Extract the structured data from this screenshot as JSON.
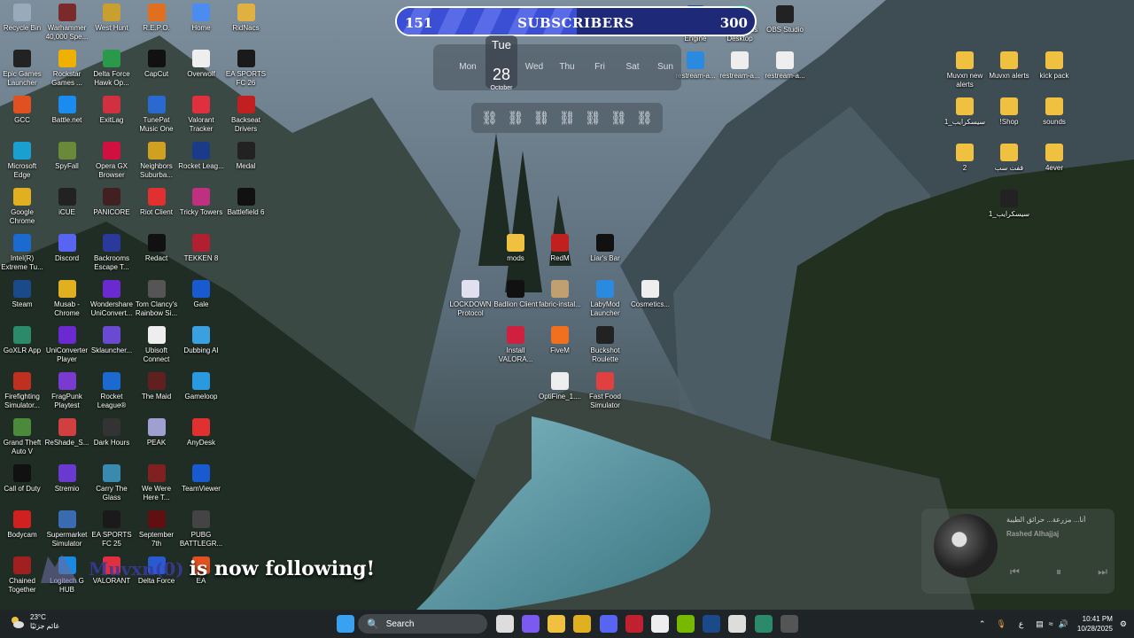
{
  "subscribers": {
    "current": "151",
    "title": "SUBSCRIBERS",
    "goal": "300",
    "progress": 0.503
  },
  "calendar": {
    "days": [
      "Mon",
      "Wed",
      "Thu",
      "Fri",
      "Sat",
      "Sun"
    ],
    "today_dayname": "Tue",
    "today_date": "28",
    "today_month": "October"
  },
  "links": {
    "glyph": "⛓",
    "count": 7
  },
  "left_icons": [
    {
      "label": "Recycle Bin",
      "color": "#9ab"
    },
    {
      "label": "Warhammer 40,000 Spe...",
      "color": "#7a2a2a"
    },
    {
      "label": "West Hunt",
      "color": "#c9a030"
    },
    {
      "label": "R.E.P.O.",
      "color": "#e07020"
    },
    {
      "label": "Home",
      "color": "#4a8cf0"
    },
    {
      "label": "RidNacs",
      "color": "#e0b040"
    },
    {
      "label": "Epic Games Launcher",
      "color": "#222"
    },
    {
      "label": "Rockstar Games ...",
      "color": "#f0b000"
    },
    {
      "label": "Delta Force Hawk Op...",
      "color": "#2a9a4a"
    },
    {
      "label": "CapCut",
      "color": "#111"
    },
    {
      "label": "Overwolf",
      "color": "#eee"
    },
    {
      "label": "EA SPORTS FC 26",
      "color": "#1a1a1a"
    },
    {
      "label": "GCC",
      "color": "#e05020"
    },
    {
      "label": "Battle.net",
      "color": "#1a8cf0"
    },
    {
      "label": "ExitLag",
      "color": "#d03040"
    },
    {
      "label": "TunePat Music One",
      "color": "#2a6ad0"
    },
    {
      "label": "Valorant Tracker",
      "color": "#e03040"
    },
    {
      "label": "Backseat Drivers",
      "color": "#c02020"
    },
    {
      "label": "Microsoft Edge",
      "color": "#1aa0d0"
    },
    {
      "label": "SpyFall",
      "color": "#6a8a3a"
    },
    {
      "label": "Opera GX Browser",
      "color": "#d01040"
    },
    {
      "label": "Neighbors Suburba...",
      "color": "#d0a020"
    },
    {
      "label": "Rocket Leag...",
      "color": "#1a3a8a"
    },
    {
      "label": "Medal",
      "color": "#222"
    },
    {
      "label": "Google Chrome",
      "color": "#e0b020"
    },
    {
      "label": "iCUE",
      "color": "#222"
    },
    {
      "label": "PANICORE",
      "color": "#402020"
    },
    {
      "label": "Riot Client",
      "color": "#e03030"
    },
    {
      "label": "Tricky Towers",
      "color": "#c03080"
    },
    {
      "label": "Battlefield 6",
      "color": "#111"
    },
    {
      "label": "Intel(R) Extreme Tu...",
      "color": "#1a6ad0"
    },
    {
      "label": "Discord",
      "color": "#5865f2"
    },
    {
      "label": "Backrooms Escape T...",
      "color": "#2a3a9a"
    },
    {
      "label": "Redact",
      "color": "#111"
    },
    {
      "label": "TEKKEN 8",
      "color": "#b02030"
    },
    {
      "label": "",
      "color": "transparent"
    },
    {
      "label": "Steam",
      "color": "#1a4a8a"
    },
    {
      "label": "Musab - Chrome",
      "color": "#e0b020"
    },
    {
      "label": "Wondershare UniConvert...",
      "color": "#6a2ad0"
    },
    {
      "label": "Tom Clancy's Rainbow Si...",
      "color": "#555"
    },
    {
      "label": "Gale",
      "color": "#1a5ad0"
    },
    {
      "label": "",
      "color": "transparent"
    },
    {
      "label": "GoXLR App",
      "color": "#2a8a6a"
    },
    {
      "label": "UniConverter Player",
      "color": "#6a2ad0"
    },
    {
      "label": "Sklauncher...",
      "color": "#6a4ad0"
    },
    {
      "label": "Ubisoft Connect",
      "color": "#eee"
    },
    {
      "label": "Dubbing AI",
      "color": "#3aa0e0"
    },
    {
      "label": "",
      "color": "transparent"
    },
    {
      "label": "Firefighting Simulator...",
      "color": "#c03020"
    },
    {
      "label": "FragPunk Playtest",
      "color": "#7a3ad0"
    },
    {
      "label": "Rocket League®",
      "color": "#1a6ad0"
    },
    {
      "label": "The Maid",
      "color": "#602020"
    },
    {
      "label": "Gameloop",
      "color": "#2a9ae0"
    },
    {
      "label": "",
      "color": "transparent"
    },
    {
      "label": "Grand Theft Auto V",
      "color": "#4a8a3a"
    },
    {
      "label": "ReShade_S...",
      "color": "#d04040"
    },
    {
      "label": "Dark Hours",
      "color": "#333"
    },
    {
      "label": "PEAK",
      "color": "#a0a0d0"
    },
    {
      "label": "AnyDesk",
      "color": "#e03030"
    },
    {
      "label": "",
      "color": "transparent"
    },
    {
      "label": "Call of Duty",
      "color": "#111"
    },
    {
      "label": "Stremio",
      "color": "#6a3ad0"
    },
    {
      "label": "Carry The Glass",
      "color": "#3a8ab0"
    },
    {
      "label": "We Were Here T...",
      "color": "#802020"
    },
    {
      "label": "TeamViewer",
      "color": "#1a5ad0"
    },
    {
      "label": "",
      "color": "transparent"
    },
    {
      "label": "Bodycam",
      "color": "#d02020"
    },
    {
      "label": "Supermarket Simulator",
      "color": "#3a6ab0"
    },
    {
      "label": "EA SPORTS FC 25",
      "color": "#1a1a1a"
    },
    {
      "label": "September 7th",
      "color": "#601010"
    },
    {
      "label": "PUBG BATTLEGR...",
      "color": "#444"
    },
    {
      "label": "",
      "color": "transparent"
    },
    {
      "label": "Chained Together",
      "color": "#a02020"
    },
    {
      "label": "Logitech G HUB",
      "color": "#1a8ae0"
    },
    {
      "label": "VALORANT",
      "color": "#e03040"
    },
    {
      "label": "Delta Force",
      "color": "#2a5ad0"
    },
    {
      "label": "EA",
      "color": "#e05020"
    },
    {
      "label": "",
      "color": "transparent"
    }
  ],
  "center_icons": [
    {
      "label": "mods",
      "color": "#f0c040"
    },
    {
      "label": "RedM",
      "color": "#c02020"
    },
    {
      "label": "Liar's Bar",
      "color": "#111"
    },
    {
      "label": "LOCKDOWN Protocol",
      "color": "#e0e0f0"
    },
    {
      "label": "Badlion Client",
      "color": "#111"
    },
    {
      "label": "fabric-instal...",
      "color": "#c0a070"
    },
    {
      "label": "LabyMod Launcher",
      "color": "#2a8ae0"
    },
    {
      "label": "Cosmetics...",
      "color": "#eee"
    },
    {
      "label": "Install VALORA...",
      "color": "#d02040"
    },
    {
      "label": "FiveM",
      "color": "#f07020"
    },
    {
      "label": "Buckshot Roulette",
      "color": "#222"
    },
    {
      "label": "OptiFine_1....",
      "color": "#eee"
    },
    {
      "label": "Fast Food Simulator",
      "color": "#e04040"
    }
  ],
  "top_right_icons": [
    {
      "label": "Wallpaper Engine",
      "color": "#1a4ad0"
    },
    {
      "label": "Streamlabs Desktop",
      "color": "#30c090"
    },
    {
      "label": "OBS Studio",
      "color": "#222"
    },
    {
      "label": "restream-a...",
      "color": "#2a8ae0"
    },
    {
      "label": "restream-a...",
      "color": "#eee"
    },
    {
      "label": "restream-a...",
      "color": "#eee"
    }
  ],
  "right_icons": [
    {
      "label": "Muvxn new alerts",
      "color": "#f0c040"
    },
    {
      "label": "Muvxn alerts",
      "color": "#f0c040"
    },
    {
      "label": "kick pack",
      "color": "#f0c040"
    },
    {
      "label": "سيسكرايب_1",
      "color": "#f0c040"
    },
    {
      "label": "!Shop",
      "color": "#f0c040"
    },
    {
      "label": "sounds",
      "color": "#f0c040"
    },
    {
      "label": "2",
      "color": "#f0c040"
    },
    {
      "label": "قفت سب",
      "color": "#f0c040"
    },
    {
      "label": "4ever",
      "color": "#f0c040"
    },
    {
      "label": "سيسكرايب_1",
      "color": "#222"
    }
  ],
  "follow_alert": {
    "name": "Muvxn(0)",
    "message": "is now following!"
  },
  "media": {
    "title": "أنا... مزرعة... حرائق الطيبة",
    "artist": "Rashed Alhajjaj",
    "prev": "⏮",
    "play": "⏸",
    "next": "⏭"
  },
  "taskbar": {
    "temp": "23°C",
    "weather": "غائم جزئيًا",
    "search_placeholder": "Search",
    "time": "10:41 PM",
    "date": "10/28/2025",
    "lang": "ع",
    "apps": [
      {
        "name": "start-icon",
        "color": "#3aa0f0"
      },
      {
        "name": "task-view-icon",
        "color": "#ddd"
      },
      {
        "name": "copilot-icon",
        "color": "#7a5af0"
      },
      {
        "name": "file-explorer-icon",
        "color": "#f0c040"
      },
      {
        "name": "chrome-icon",
        "color": "#e0b020"
      },
      {
        "name": "discord-icon",
        "color": "#5865f2"
      },
      {
        "name": "app-red-icon",
        "color": "#c02030"
      },
      {
        "name": "app-ring-icon",
        "color": "#eee"
      },
      {
        "name": "nvidia-icon",
        "color": "#76b900"
      },
      {
        "name": "steam-icon",
        "color": "#1a4a8a"
      },
      {
        "name": "app-g-icon",
        "color": "#ddd"
      },
      {
        "name": "goxlr-icon",
        "color": "#2a8a6a"
      },
      {
        "name": "obs-icon",
        "color": "#555"
      }
    ]
  }
}
